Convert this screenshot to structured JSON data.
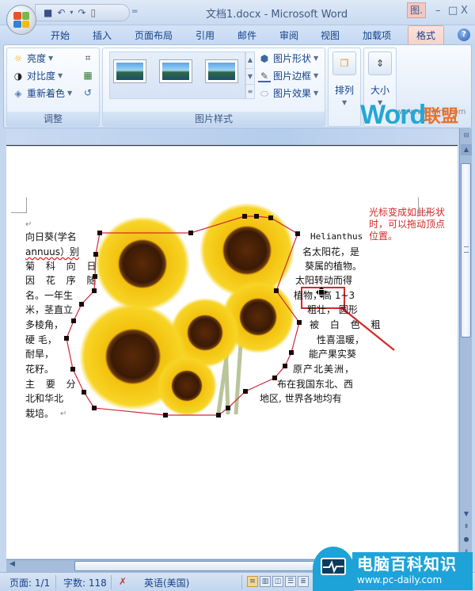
{
  "window": {
    "title": "文档1.docx - Microsoft Word",
    "context_tab_title": "图.",
    "controls": {
      "minimize": "–",
      "maximize": "□",
      "close": "X"
    }
  },
  "quick_access": {
    "items": [
      {
        "name": "save",
        "glyph": "💾"
      },
      {
        "name": "undo",
        "glyph": "↶"
      },
      {
        "name": "undo-dropdown",
        "glyph": "▾"
      },
      {
        "name": "redo",
        "glyph": "↷"
      },
      {
        "name": "new-doc",
        "glyph": "▯"
      }
    ],
    "more": "="
  },
  "tabs": [
    {
      "label": "开始",
      "active": false
    },
    {
      "label": "插入",
      "active": false
    },
    {
      "label": "页面布局",
      "active": false
    },
    {
      "label": "引用",
      "active": false
    },
    {
      "label": "邮件",
      "active": false
    },
    {
      "label": "审阅",
      "active": false
    },
    {
      "label": "视图",
      "active": false
    },
    {
      "label": "加载项",
      "active": false
    },
    {
      "label": "格式",
      "active": true
    }
  ],
  "help_glyph": "?",
  "ribbon": {
    "adjust": {
      "label": "调整",
      "brightness": "亮度",
      "contrast": "对比度",
      "recolor": "重新着色"
    },
    "picture_styles": {
      "label": "图片样式",
      "shape": "图片形状",
      "border": "图片边框",
      "effects": "图片效果"
    },
    "arrange": {
      "label": "排列"
    },
    "size": {
      "label": "大小"
    }
  },
  "watermark_top": {
    "word": "Word",
    "lm": "联盟",
    "url": "www.wordlm.com"
  },
  "document": {
    "left_column": [
      "向日葵(学名",
      "annuus）别",
      "菊 科 向 日",
      "因 花 序 随",
      "名。一年生",
      "米，茎直立",
      "多棱角，",
      "硬 毛，",
      "耐旱，",
      "花籽。",
      "主 要 分",
      "北和华北",
      "栽培。"
    ],
    "right_column": [
      "Helianthus",
      "名太阳花，是",
      "葵属的植物。",
      "太阳转动而得",
      "植物，高 1~3",
      "粗壮， 圆形",
      "被 白 色 粗",
      "性喜温暖，",
      "能产果实葵",
      "原产北美洲，",
      "布在我国东北、西",
      "地区, 世界各地均有"
    ],
    "paragraph_mark": "↵",
    "annotation": "光标变成如此形状时，可以拖动顶点位置。"
  },
  "statusbar": {
    "page": "页面: 1/1",
    "words": "字数: 118",
    "language": "英语(美国)"
  },
  "watermark_bottom": {
    "title": "电脑百科知识",
    "url": "www.pc-daily.com"
  },
  "colors": {
    "accent_tab": "#f6d2ca",
    "wrap_polygon": "#d0283c",
    "annotation": "#d62828",
    "wm_word": "#25a7d4",
    "wm_lm": "#e9712d",
    "pcd_blue": "#1ea3d8"
  }
}
